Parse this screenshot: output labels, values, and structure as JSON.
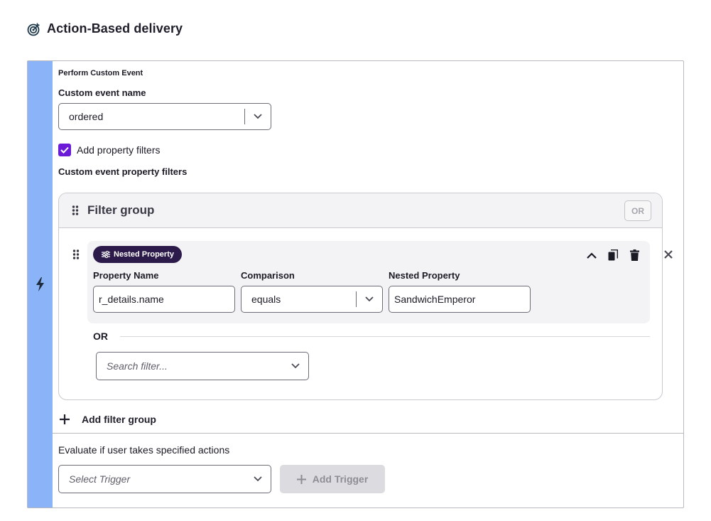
{
  "header": {
    "title": "Action-Based delivery",
    "icon": "target-icon"
  },
  "card": {
    "section_label": "Perform Custom Event",
    "custom_event": {
      "label": "Custom event name",
      "value": "ordered"
    },
    "property_filters_checkbox": {
      "label": "Add property filters",
      "checked": true
    },
    "filters_label": "Custom event property filters",
    "filter_group": {
      "title": "Filter group",
      "or_badge": "OR",
      "row": {
        "chip_label": "Nested Property",
        "property_name": {
          "label": "Property Name",
          "value": "r_details.name"
        },
        "comparison": {
          "label": "Comparison",
          "value": "equals"
        },
        "nested_property": {
          "label": "Nested Property",
          "value": "SandwichEmperor"
        }
      },
      "or_separator": "OR",
      "search_filter": {
        "placeholder": "Search filter..."
      }
    },
    "add_filter_group": "Add filter group",
    "evaluate_label": "Evaluate if user takes specified actions",
    "trigger_select": {
      "placeholder": "Select Trigger"
    },
    "add_trigger": "Add Trigger"
  },
  "colors": {
    "rail": "#8ab3f8",
    "checkbox": "#6b1bd8",
    "chip": "#2c1a4a"
  }
}
